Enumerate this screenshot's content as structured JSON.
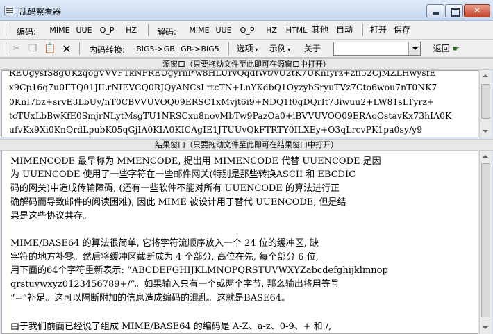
{
  "window": {
    "title": "乱码察看器"
  },
  "toolbar1": {
    "encode_label": "编码:",
    "encode_buttons": [
      "MIME",
      "UUE",
      "Q_P",
      "HZ"
    ],
    "decode_label": "解码:",
    "decode_buttons": [
      "MIME",
      "UUE",
      "Q_P",
      "HZ",
      "HTML",
      "其他",
      "自动"
    ],
    "open_label": "打开",
    "save_label": "保存"
  },
  "toolbar2": {
    "convert_label": "内码转换:",
    "big5_gb": "BIG5->GB",
    "gb_big5": "GB->BIG5",
    "options_label": "选项",
    "example_label": "示例",
    "about_label": "关于",
    "combo_value": "",
    "back_label": "返回"
  },
  "source": {
    "header": "源窗口（只要拖动文件至此即可在源窗口中打开）",
    "lines": [
      "REUgysfS8gUKzqogVVVFTkNPREUgyrnl*w8HLUrvQqdfWt/vU2tK7UKnIyrz+zfi52CjMZLHwysfE",
      "x9Cp16q7u0FTQ01JILrNIEVCQ0RJQyANCsLrtcTN+LnYKdbQ1OyzybSryuTVz7Cto6wou7nT0NK7",
      "0KnI7bz+srvE3LbUy/nT0CBVVUVOQ09ERSC1xMvjt6i9+NDQ1f0gDQrIt73iwuu2+LW81sLTyrz+",
      "tcTUxLbBwKfE0SmjrNLytMsgTU1NRSCxu8novMbTw9PazOa0+iBVVUVOQ09ERAoOstavKx73hIA0K",
      "ufvKx9Xi0KnQrdLpubK05qGjIA0KIA0KICAgIE1JTUUvQkFTRTY0ILXEy+O3qLrcvPK1pa0sy/y9"
    ]
  },
  "result": {
    "header": "结果窗口（只要拖动文件至此即可在结果窗口中打开）",
    "lines": [
      "MIMENCODE 最早称为 MMENCODE, 提出用 MIMENCODE 代替 UUENCODE 是因",
      "为 UUENCODE 使用了一些字符在一些邮件网关(特别是那些转换ASCII 和 EBCDIC",
      "码的网关)中造成传输障碍, (还有一些软件不能对所有 UUENCODE 的算法进行正",
      "确解码而导致邮件的阅读困难), 因此 MIME 被设计用于替代 UUENCODE, 但是结",
      "果是这些协议共存。",
      "",
      "    MIME/BASE64 的算法很简单, 它将字符流顺序放入一个 24 位的缓冲区, 缺",
      "字符的地方补零。然后将缓冲区截断成为 4 个部分, 高位在先, 每个部分 6 位,",
      "用下面的64个字符重新表示: “ABCDEFGHIJKLMNOPQRSTUVWXYZabcdefghijklmnop",
      "qrstuvwxyz0123456789+/”。如果输入只有一个或两个字节, 那么输出将用等号",
      "“=”补足。这可以隔断附加的信息造成编码的混乱。这就是BASE64。",
      "",
      "由于我们前面已经说了组成 MIME/BASE64 的编码是 A-Z、a-z、0-9、+ 和 /,"
    ]
  }
}
